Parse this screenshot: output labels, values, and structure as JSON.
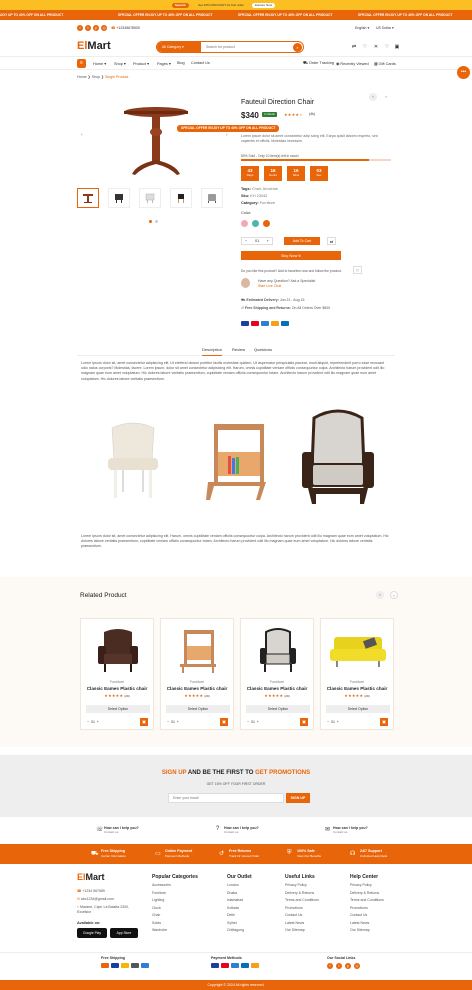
{
  "topbar": {
    "sale": "Special",
    "offer": "Get 10% DISCOUNT for first order",
    "shop": "Explore Now"
  },
  "ticker": [
    "ENJOY UP TO 40% OFF ON ALL PRODUCT",
    "SPECIAL OFFER ENJOY UP TO 40% OFF ON ALL PRODUCT",
    "SPECIAL OFFER ENJOY UP TO 40% OFF ON ALL PRODUCT",
    "SPECIAL OFFER ENJOY UP TO 40% OFF ON ALL PRODUCT"
  ],
  "header": {
    "phone": "+12345678900",
    "language": "English",
    "currency": "US Dollar",
    "logo_a": "El",
    "logo_b": "Mart",
    "category": "All Category",
    "search_placeholder": "Search for product"
  },
  "nav": {
    "items": [
      "Home",
      "Shop",
      "Product",
      "Pages",
      "Blog",
      "Contact Us"
    ],
    "right": [
      "Order Tracking",
      "Recently Viewed",
      "Gift Cards"
    ]
  },
  "breadcrumb": {
    "home": "Home",
    "shop": "Shop",
    "current": "Single Product"
  },
  "product": {
    "title": "Fauteuil Direction Chair",
    "price": "$340",
    "stock": "In Stock",
    "reviews": "(4k)",
    "sold_label": "",
    "brand": "",
    "overlay_offer": "SPECIAL OFFER ENJOY UP TO 40% OFF ON ALL PRODUCT",
    "description": "Lorem ipsum dolor sit amet consectetur adip scing elit. Earpa quisit laboreo esperto, sint vapientis et officiis. Molestias necessim.",
    "hurry": "80% Sold - Only 10 item(s) left in stock!",
    "countdown": [
      {
        "v": "43",
        "l": "Days"
      },
      {
        "v": "16",
        "l": "Hours"
      },
      {
        "v": "16",
        "l": "Mins"
      },
      {
        "v": "03",
        "l": "Sec"
      }
    ],
    "tags_label": "Tags:",
    "tags": "Chair, Armchair",
    "sku_label": "Sku:",
    "sku": "KH 23042",
    "category_label": "Category:",
    "category": "Furniture",
    "color_label": "Color:",
    "colors": [
      "#f4a9b8",
      "#4db6ac",
      "#e8650a"
    ],
    "qty": "01",
    "add_to_cart": "Add To Cart",
    "buy_now": "Buy Now It",
    "wishlist_note": "Do you like this product? Add to favorites now and follow the product.",
    "question": "Have any Question? Ask a Specialist",
    "live_chat": "Start Live Chat",
    "delivery_label": "Estimated Delivery:",
    "delivery": "Jun 21 - Aug 15",
    "shipping_label": "Free Shipping and Returns:",
    "shipping": "On All Orders Over $500"
  },
  "tabs": [
    "Description",
    "Review",
    "Questions"
  ],
  "desc_paras": [
    "Lorem ipsum dolor sit, amet consectetur adipisicing elit. Ut eleifend dictum porttitor facilis molestiae quidem. Ut aspernatur perspiciatis placeat, modi aliquid, reprehenderit porro esse recusant odio natus corporis? Molestias, facere. Lorem ipsum, dolor sit amet consectetur adipisicing elit. Harum, omnis cupiditate veniam officiis consequuntur culpa. Architecto harum provident odit illo magnam quae eum amet voluptatum. Hic dolores labore veritatis praesentium, cupiditate veniam officiis consequuntur totam. Architecto harum provident odit illo magnam quae eum amet voluptatum. Hic dolores labore veritatis praesentium.",
    "Lorem ipsum dolor sit, amet consectetur adipisicing elit. Harum, omnis cupiditate veniam officiis consequuntur culpa. Architecto harum provident odit illo magnam quae eum amet voluptatum. Hic dolores labore veritatis praesentium, cupiditate veniam officiis consequuntur totam. Architecto harum provident odit illo magnam quae eum amet voluptatum. Hic dolores labore veritatis praesentium."
  ],
  "related": {
    "title": "Related Product",
    "products": [
      {
        "cat": "Furniture",
        "name": "Classic Eames Plastic chair",
        "reviews": "(20)",
        "option": "Select Option",
        "qty": "01"
      },
      {
        "cat": "Furniture",
        "name": "Classic Eames Plastic chair",
        "reviews": "(20)",
        "option": "Select Option",
        "qty": "01"
      },
      {
        "cat": "Furniture",
        "name": "Classic Eames Plastic chair",
        "reviews": "(20)",
        "option": "Select Option",
        "qty": "01"
      },
      {
        "cat": "Furniture",
        "name": "Classic Eames Plastic chair",
        "reviews": "(20)",
        "option": "Select Option",
        "qty": "01"
      }
    ]
  },
  "newsletter": {
    "a": "SIGN UP",
    "b": " AND BE THE FIRST TO ",
    "c": "GET PROMOTIONS",
    "sub": "GET 15% OFF YOUR FIRST ORDER",
    "placeholder": "Enter your email",
    "button": "SIGN UP"
  },
  "help": [
    {
      "t": "How can I help you?",
      "s": "Contact us"
    },
    {
      "t": "How can I help you?",
      "s": "Contact us"
    },
    {
      "t": "How can I help you?",
      "s": "Contact us"
    }
  ],
  "features": [
    {
      "t": "Free Shipping",
      "s": "Carrier Information"
    },
    {
      "t": "Online Payment",
      "s": "Payment Methods"
    },
    {
      "t": "Free Returns",
      "s": "Track Or Cancel Order"
    },
    {
      "t": "100% Safe",
      "s": "View Our Benefits"
    },
    {
      "t": "24/7 Support",
      "s": "Unlimited Help Desk"
    }
  ],
  "footer": {
    "phone": "+1234 567689",
    "email": "abc1234@gmail.com",
    "address": "Maxime, Capt. La Bolatta 2300, Excelsior",
    "available": "Available on:",
    "google": "Google Play",
    "apple": "App Store",
    "col2": {
      "title": "Popular Categories",
      "links": [
        "Accessories",
        "Furniture",
        "Lighting",
        "Clock",
        "Chair",
        "Sofas",
        "Wardrobe"
      ]
    },
    "col3": {
      "title": "Our Outlet",
      "links": [
        "London",
        "Dhaka",
        "Islamabad",
        "Kolkata",
        "Delhi",
        "Sylhet",
        "Chittagong"
      ]
    },
    "col4": {
      "title": "Useful Links",
      "links": [
        "Privacy Policy",
        "Delivery & Returns",
        "Terms and Conditions",
        "Promotions",
        "Contact Us",
        "Latest News",
        "Our Sitemap"
      ]
    },
    "col5": {
      "title": "Help Center",
      "links": [
        "Privacy Policy",
        "Delivery & Returns",
        "Terms and Conditions",
        "Promotions",
        "Contact Us",
        "Latest News",
        "Our Sitemap"
      ]
    },
    "free_shipping": "Free Shipping",
    "payment_methods": "Payment Methods",
    "social": "Our Social Links",
    "copyright": "Copyright © 2024 All rights reserved."
  }
}
